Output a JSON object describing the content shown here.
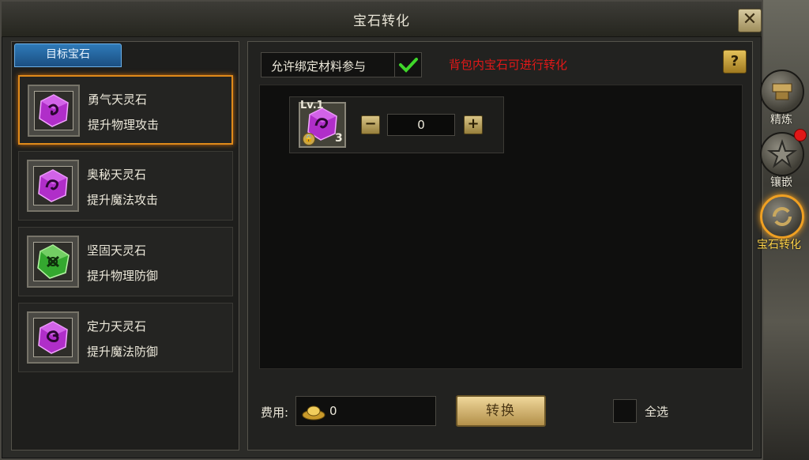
{
  "window": {
    "title": "宝石转化",
    "close_label": "✕"
  },
  "left": {
    "tab_label": "目标宝石",
    "gems": [
      {
        "name": "勇气天灵石",
        "desc": "提升物理攻击",
        "color": "#c33bd6",
        "selected": true
      },
      {
        "name": "奥秘天灵石",
        "desc": "提升魔法攻击",
        "color": "#c33bd6",
        "selected": false
      },
      {
        "name": "坚固天灵石",
        "desc": "提升物理防御",
        "color": "#3fbf3a",
        "selected": false
      },
      {
        "name": "定力天灵石",
        "desc": "提升魔法防御",
        "color": "#c33bd6",
        "selected": false
      }
    ]
  },
  "right": {
    "allow_bound_label": "允许绑定材料参与",
    "allow_bound_checked": true,
    "hint": "背包内宝石可进行转化",
    "help_label": "?",
    "material": {
      "level": "Lv.1",
      "count": "3",
      "quantity": "0",
      "color": "#c33bd6"
    },
    "minus_label": "−",
    "plus_label": "+",
    "fee_label": "费用:",
    "fee_value": "0",
    "convert_label": "转换",
    "select_all_label": "全选"
  },
  "side_tabs": [
    {
      "label": "精炼",
      "icon": "anvil-icon",
      "active": false
    },
    {
      "label": "镶嵌",
      "icon": "star-icon",
      "active": false,
      "badge": true
    },
    {
      "label": "宝石转化",
      "icon": "cycle-icon",
      "active": true
    }
  ],
  "colors": {
    "accent": "#e08a1a",
    "hint": "#e01818",
    "tab_blue": "#2e7ab8"
  }
}
